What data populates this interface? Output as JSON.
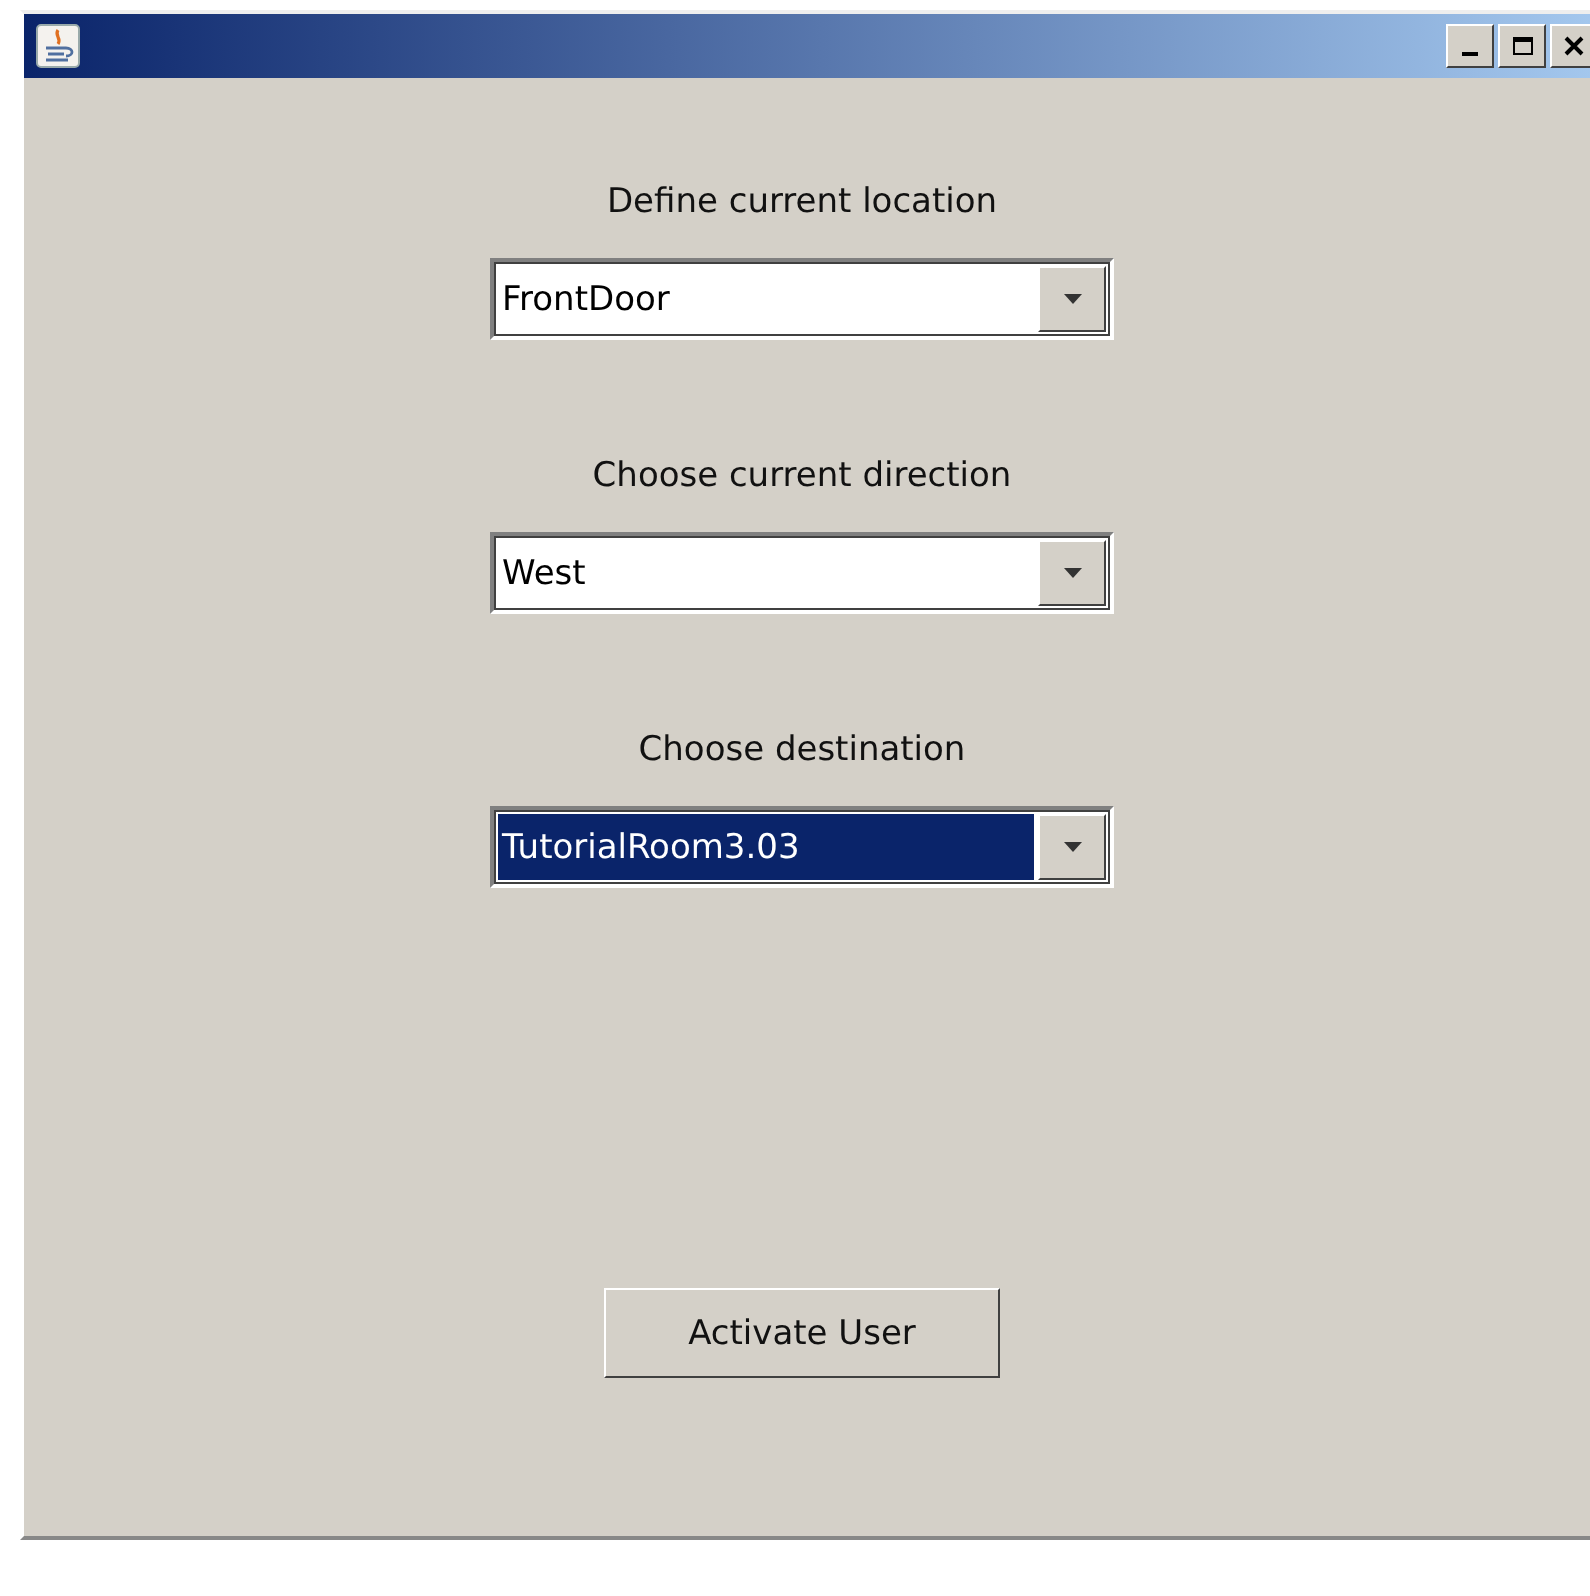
{
  "fields": [
    {
      "label": "Define current location",
      "value": "FrontDoor",
      "focused": false
    },
    {
      "label": "Choose current direction",
      "value": "West",
      "focused": false
    },
    {
      "label": "Choose destination",
      "value": "TutorialRoom3.03",
      "focused": true
    }
  ],
  "button": "Activate User"
}
